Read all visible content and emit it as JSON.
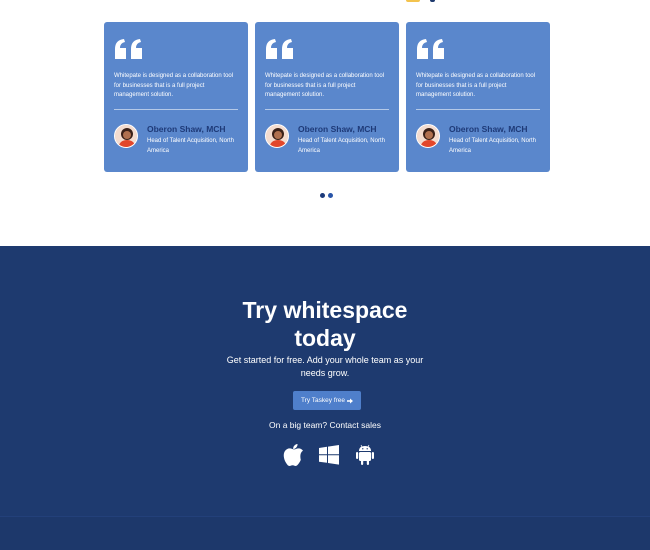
{
  "testimonials": [
    {
      "quote": "Whitepate is designed as a collaboration tool for businesses that is a full project management solution.",
      "name": "Oberon Shaw, MCH",
      "role": "Head of Talent Acquisition, North America"
    },
    {
      "quote": "Whitepate is designed as a collaboration tool for businesses that is a full project management solution.",
      "name": "Oberon Shaw, MCH",
      "role": "Head of Talent Acquisition, North America"
    },
    {
      "quote": "Whitepate is designed as a collaboration tool for businesses that is a full project management solution.",
      "name": "Oberon Shaw, MCH",
      "role": "Head of Talent Acquisition, North America"
    }
  ],
  "carousel": {
    "dots": 2,
    "active_index": 0
  },
  "cta": {
    "title_line1": "Try whitespace",
    "title_line2": "today",
    "subtitle_line1": "Get started for free. Add your whole team as your",
    "subtitle_line2": "needs grow.",
    "button_label": "Try Taskey free",
    "contact_text": "On a big team? Contact sales",
    "platforms": [
      "apple-icon",
      "windows-icon",
      "android-icon"
    ]
  },
  "colors": {
    "card_bg": "#5a87cc",
    "cta_bg": "#1e3a6f",
    "button_bg": "#4f7fcb",
    "name_color": "#1e3a78"
  }
}
